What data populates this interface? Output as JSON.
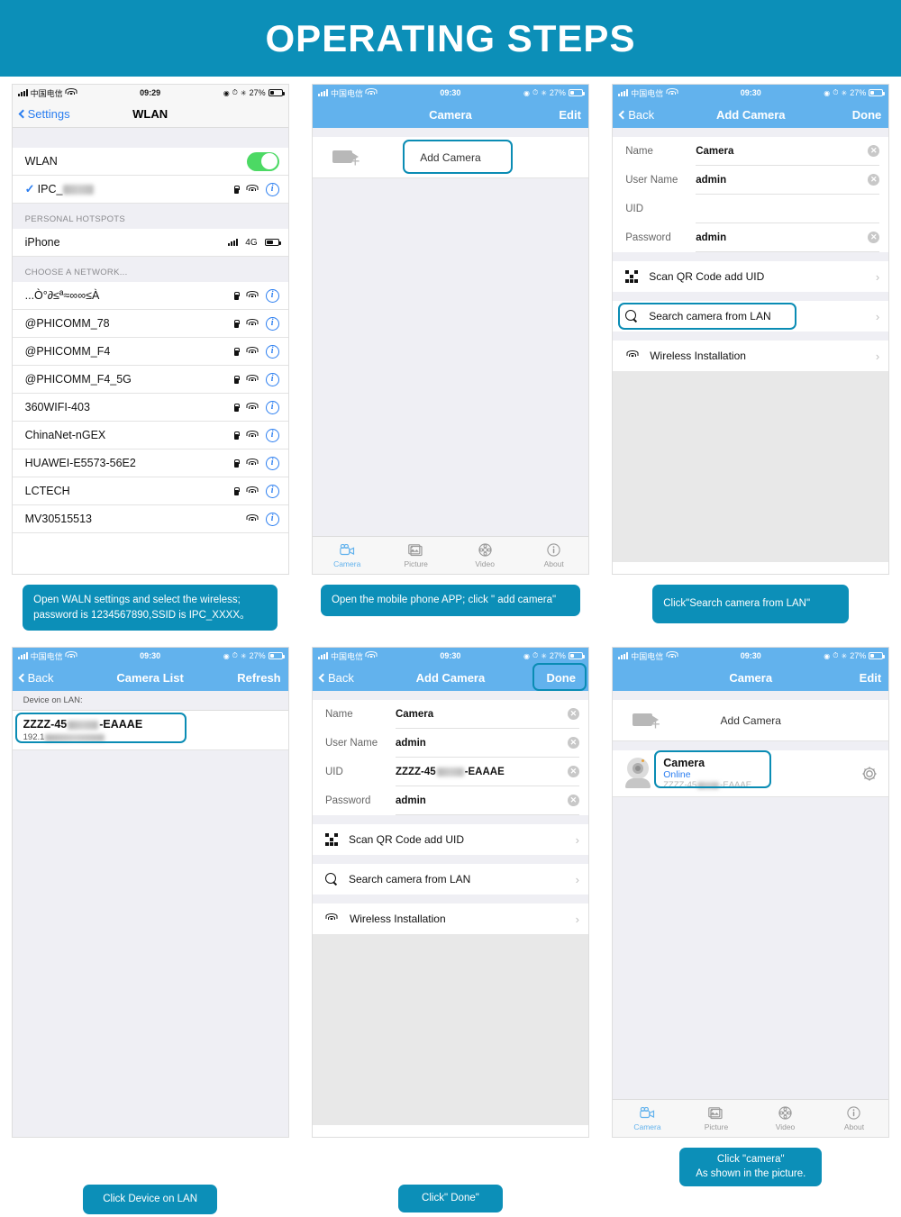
{
  "banner": {
    "title": "OPERATING STEPS",
    "bg": "#0c8fb8"
  },
  "theme": {
    "accent": "#0c8fb8",
    "nav_blue": "#62b2ed",
    "link_blue": "#2b7ef0",
    "switch_green": "#4cd964",
    "highlight": "#0a8cb4"
  },
  "steps": [
    {
      "id": "step1-wlan",
      "status": {
        "carrier": "中国电信",
        "time": "09:29",
        "battery": "27%"
      },
      "nav": {
        "back": "Settings",
        "title": "WLAN",
        "right": ""
      },
      "wlan_row": {
        "label": "WLAN",
        "toggle": "on"
      },
      "connected": {
        "ssid": "IPC_",
        "redacted": true
      },
      "hotspot_header": "PERSONAL HOTSPOTS",
      "hotspot": {
        "label": "iPhone",
        "network": "4G"
      },
      "choose_header": "CHOOSE A NETWORK...",
      "networks": [
        {
          "ssid": "...Ò°∂≤ª≈∞∞≤À",
          "locked": true
        },
        {
          "ssid": "@PHICOMM_78",
          "locked": true
        },
        {
          "ssid": "@PHICOMM_F4",
          "locked": true
        },
        {
          "ssid": "@PHICOMM_F4_5G",
          "locked": true
        },
        {
          "ssid": "360WIFI-403",
          "locked": true
        },
        {
          "ssid": "ChinaNet-nGEX",
          "locked": true
        },
        {
          "ssid": "HUAWEI-E5573-56E2",
          "locked": true
        },
        {
          "ssid": "LCTECH",
          "locked": true
        },
        {
          "ssid": "MV30515513",
          "locked": false
        }
      ],
      "caption": "Open WALN settings and select the wireless; password is 1234567890,SSID is IPC_XXXX。"
    },
    {
      "id": "step2-camera",
      "status": {
        "carrier": "中国电信",
        "time": "09:30",
        "battery": "27%"
      },
      "nav": {
        "back": "",
        "title": "Camera",
        "right": "Edit"
      },
      "add_camera": "Add Camera",
      "tabs": [
        {
          "label": "Camera",
          "icon": "camcorder-icon",
          "active": true
        },
        {
          "label": "Picture",
          "icon": "photos-icon",
          "active": false
        },
        {
          "label": "Video",
          "icon": "film-reel-icon",
          "active": false
        },
        {
          "label": "About",
          "icon": "info-icon",
          "active": false
        }
      ],
      "caption": "Open the mobile phone APP; click \" add camera\""
    },
    {
      "id": "step3-addcamera",
      "status": {
        "carrier": "中国电信",
        "time": "09:30",
        "battery": "27%"
      },
      "nav": {
        "back": "Back",
        "title": "Add Camera",
        "right": "Done"
      },
      "fields": [
        {
          "label": "Name",
          "value": "Camera",
          "clearable": true
        },
        {
          "label": "User Name",
          "value": "admin",
          "clearable": true
        },
        {
          "label": "UID",
          "value": "",
          "clearable": false
        },
        {
          "label": "Password",
          "value": "admin",
          "clearable": true
        }
      ],
      "menu": [
        {
          "label": "Scan QR Code add UID",
          "icon": "qr-code-icon",
          "highlighted": false
        },
        {
          "label": "Search camera from LAN",
          "icon": "magnifier-icon",
          "highlighted": true
        },
        {
          "label": "Wireless Installation",
          "icon": "wifi-icon",
          "highlighted": false
        }
      ],
      "caption": "Click\"Search camera from LAN\""
    },
    {
      "id": "step4-cameralist",
      "status": {
        "carrier": "中国电信",
        "time": "09:30",
        "battery": "27%"
      },
      "nav": {
        "back": "Back",
        "title": "Camera List",
        "right": "Refresh"
      },
      "device_header": "Device on LAN:",
      "device": {
        "uid_prefix": "ZZZZ-45",
        "uid_suffix": "-EAAAE",
        "ip_prefix": "192.1",
        "highlighted": true
      },
      "caption": "Click Device on LAN"
    },
    {
      "id": "step5-addcamera-filled",
      "status": {
        "carrier": "中国电信",
        "time": "09:30",
        "battery": "27%"
      },
      "nav": {
        "back": "Back",
        "title": "Add Camera",
        "right": "Done",
        "right_highlighted": true
      },
      "fields": [
        {
          "label": "Name",
          "value": "Camera",
          "clearable": true
        },
        {
          "label": "User Name",
          "value": "admin",
          "clearable": true
        },
        {
          "label": "UID",
          "value": "ZZZZ-45",
          "value_suffix": "-EAAAE",
          "redacted": true,
          "clearable": true
        },
        {
          "label": "Password",
          "value": "admin",
          "clearable": true
        }
      ],
      "menu": [
        {
          "label": "Scan QR Code add UID",
          "icon": "qr-code-icon",
          "highlighted": false
        },
        {
          "label": "Search camera from LAN",
          "icon": "magnifier-icon",
          "highlighted": false
        },
        {
          "label": "Wireless Installation",
          "icon": "wifi-icon",
          "highlighted": false
        }
      ],
      "caption": "Click\"  Done\""
    },
    {
      "id": "step6-camera-online",
      "status": {
        "carrier": "中国电信",
        "time": "09:30",
        "battery": "27%"
      },
      "nav": {
        "back": "",
        "title": "Camera",
        "right": "Edit"
      },
      "add_camera": "Add Camera",
      "entry": {
        "name": "Camera",
        "status": "Online",
        "uid_prefix": "ZZZZ-45",
        "uid_suffix": "-EAAAE",
        "highlighted": true
      },
      "tabs": [
        {
          "label": "Camera",
          "icon": "camcorder-icon",
          "active": true
        },
        {
          "label": "Picture",
          "icon": "photos-icon",
          "active": false
        },
        {
          "label": "Video",
          "icon": "film-reel-icon",
          "active": false
        },
        {
          "label": "About",
          "icon": "about-icon",
          "active": false
        }
      ],
      "caption_line1": "Click \"camera\"",
      "caption_line2": "As shown in the picture."
    }
  ]
}
